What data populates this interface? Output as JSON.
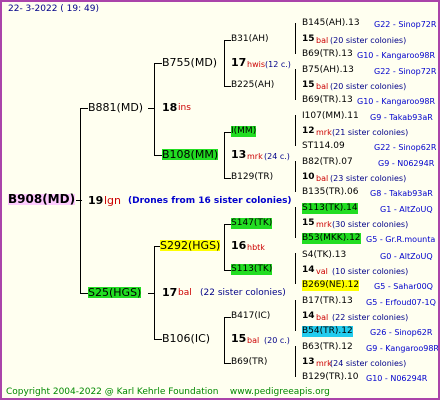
{
  "header": {
    "date": "22-  3-2022 ( 19: 49)"
  },
  "footer": {
    "copyright": "Copyright 2004-2022 @ Karl Kehrle Foundation",
    "site": "www.pedigreeapis.org"
  },
  "root": {
    "id": "B908(MD)",
    "number": "19",
    "code": "lgn",
    "note": "(Drones from 16 sister colonies)"
  },
  "gen1": [
    {
      "id": "B881(MD)",
      "number": "18",
      "code": "ins"
    },
    {
      "id": "S25(HGS)",
      "number": "17",
      "code": "bal",
      "note": "(22 sister colonies)"
    }
  ],
  "gen2": [
    {
      "id": "B755(MD)",
      "number": "17",
      "code": "hwis",
      "note": "(12 c.)"
    },
    {
      "id": "B108(MM)",
      "number": "13",
      "code": "mrk",
      "note": "(24 c.)"
    },
    {
      "id": "S292(HGS)",
      "number": "16",
      "code": "hbtk"
    },
    {
      "id": "B106(IC)",
      "number": "15",
      "code": "bal",
      "note": "(20 c.)"
    }
  ],
  "gen3": [
    {
      "id": "B31(AH)"
    },
    {
      "id": "B225(AH)"
    },
    {
      "id": "I(MM)"
    },
    {
      "id": "B129(TR)"
    },
    {
      "id": "S147(TK)"
    },
    {
      "id": "S113(TK)"
    },
    {
      "id": "B417(IC)"
    },
    {
      "id": "B69(TR)"
    }
  ],
  "gen4": [
    {
      "top": "B145(AH).13",
      "top_right": "G22 - Sinop72R",
      "mid_num": "15",
      "mid_code": "bal",
      "mid_note": "(20 sister colonies)",
      "bot": "B69(TR).13",
      "bot_right": "G10 - Kangaroo98R"
    },
    {
      "top": "B75(AH).13",
      "top_right": "G22 - Sinop72R",
      "mid_num": "15",
      "mid_code": "bal",
      "mid_note": "(20 sister colonies)",
      "bot": "B69(TR).13",
      "bot_right": "G10 - Kangaroo98R"
    },
    {
      "top": "I107(MM).11",
      "top_right": "G9 - Takab93aR",
      "mid_num": "12",
      "mid_code": "mrk",
      "mid_note": "(21 sister colonies)",
      "bot": "ST114.09",
      "bot_right": "G22 - Sinop62R"
    },
    {
      "top": "B82(TR).07",
      "top_right": "G9 - N06294R",
      "mid_num": "10",
      "mid_code": "bal",
      "mid_note": "(23 sister colonies)",
      "bot": "B135(TR).06",
      "bot_right": "G8 - Takab93aR"
    },
    {
      "top": "S113(TK).14",
      "top_right": "G1 - AltZoUQ",
      "mid_num": "15",
      "mid_code": "mrk",
      "mid_note": "(30 sister colonies)",
      "bot": "B53(MKK).12",
      "bot_right": "G5 - Gr.R.mounta"
    },
    {
      "top": "S4(TK).13",
      "top_right": "G0 - AltZoUQ",
      "mid_num": "14",
      "mid_code": "val",
      "mid_note": "(10 sister colonies)",
      "bot": "B269(NE).12",
      "bot_right": "G5 - Sahar00Q"
    },
    {
      "top": "B17(TR).13",
      "top_right": "G5 - Erfoud07-1Q",
      "mid_num": "14",
      "mid_code": "bal",
      "mid_note": "(22 sister colonies)",
      "bot": "B54(TR).12",
      "bot_right": "G26 - Sinop62R"
    },
    {
      "top": "B63(TR).12",
      "top_right": "G9 - Kangaroo98R",
      "mid_num": "13",
      "mid_code": "mrk",
      "mid_note": "(24 sister colonies)",
      "bot": "B129(TR).10",
      "bot_right": "G10 - N06294R"
    }
  ]
}
